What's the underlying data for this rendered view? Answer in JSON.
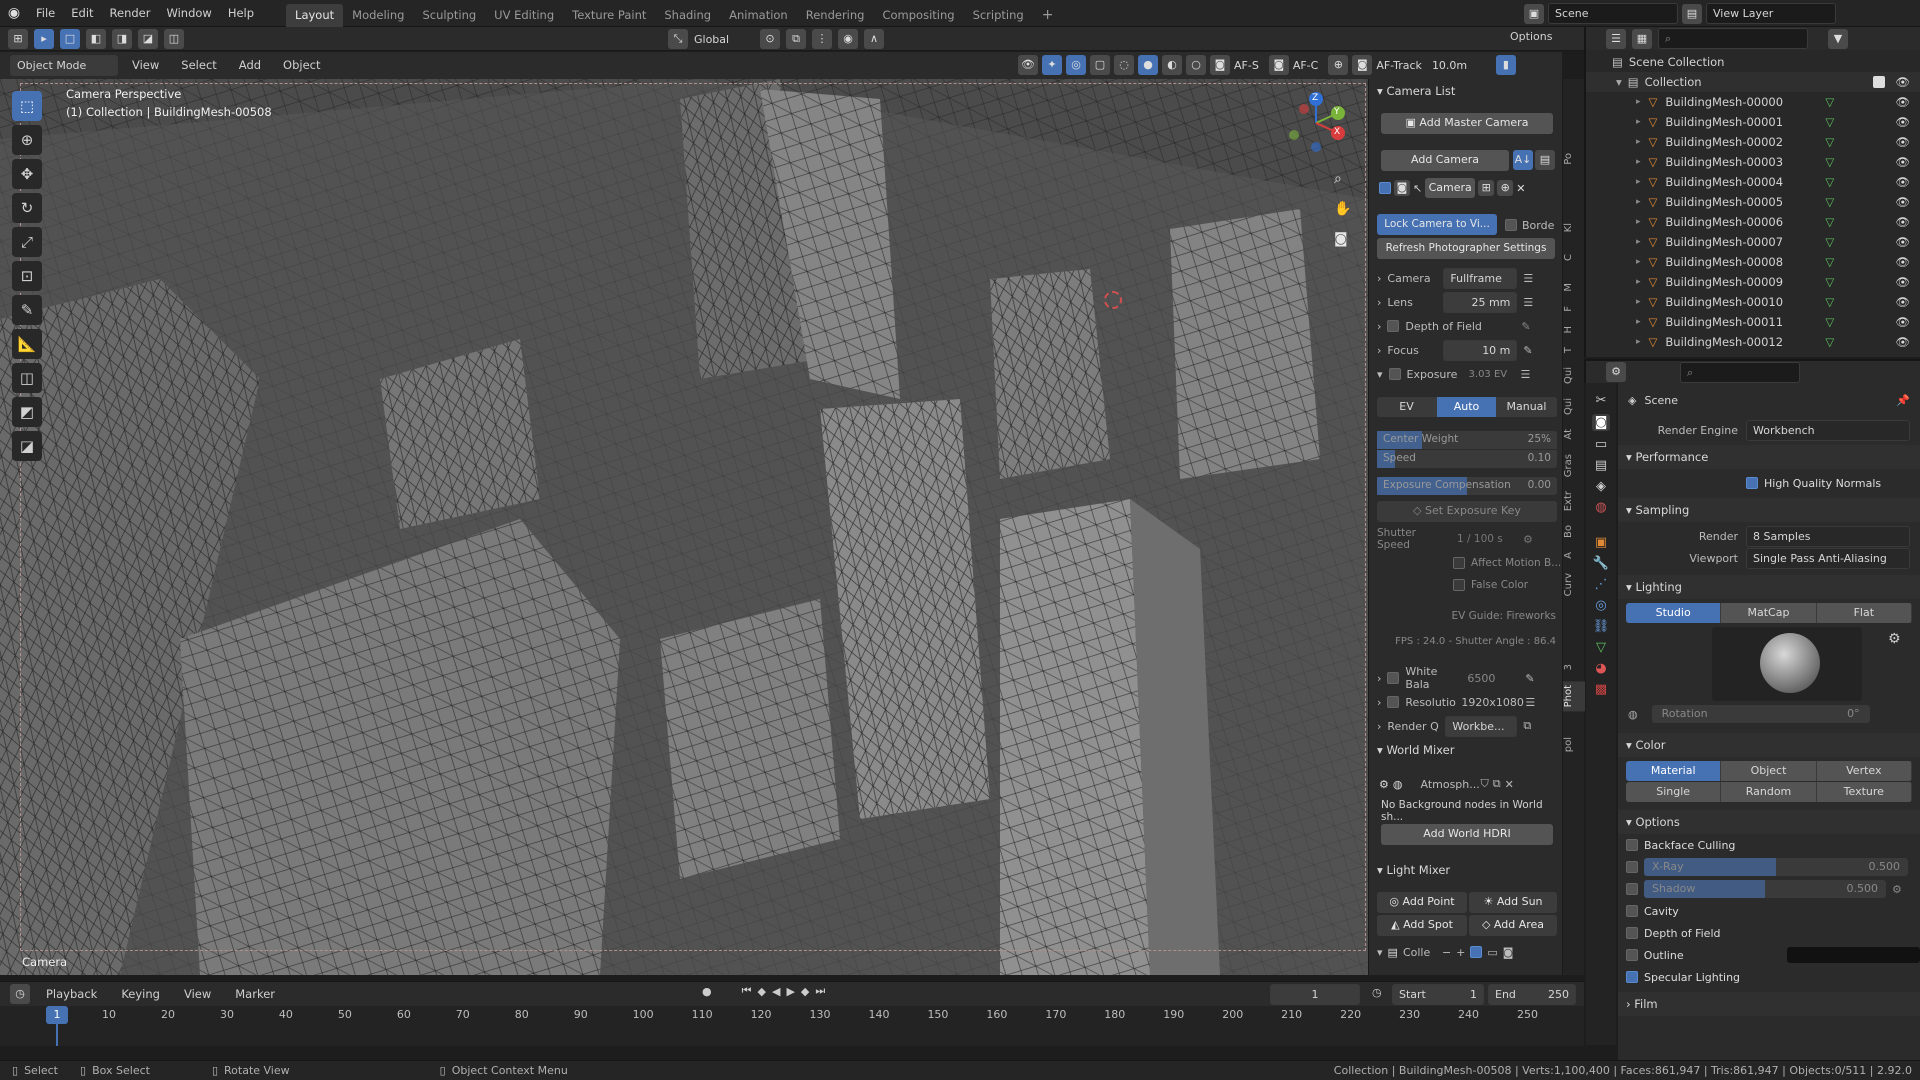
{
  "topbar": {
    "menus": [
      "File",
      "Edit",
      "Render",
      "Window",
      "Help"
    ],
    "workspaces": [
      "Layout",
      "Modeling",
      "Sculpting",
      "UV Editing",
      "Texture Paint",
      "Shading",
      "Animation",
      "Rendering",
      "Compositing",
      "Scripting"
    ],
    "active_workspace": "Layout",
    "scene_field": "Scene",
    "view_layer_field": "View Layer"
  },
  "toolbar2": {
    "transform_orientation": "Global",
    "options_label": "Options"
  },
  "viewport_header": {
    "mode": "Object Mode",
    "menus": [
      "View",
      "Select",
      "Add",
      "Object"
    ],
    "af_s": "AF-S",
    "af_c": "AF-C",
    "af_track": "AF-Track",
    "distance": "10.0m"
  },
  "viewport": {
    "line1": "Camera Perspective",
    "line2": "(1) Collection | BuildingMesh-00508",
    "bottom_label": "Camera",
    "bg_color": "#4d4d4d",
    "gizmo_x": "X",
    "gizmo_y": "Y",
    "gizmo_z": "Z"
  },
  "npanel": {
    "camera_list_title": "Camera List",
    "add_master_camera": "Add Master Camera",
    "add_camera": "Add Camera",
    "camera_name": "Camera",
    "lock_camera": "Lock Camera to Vi...",
    "border": "Borde",
    "refresh": "Refresh Photographer Settings",
    "camera_label": "Camera",
    "camera_value": "Fullframe",
    "lens_label": "Lens",
    "lens_value": "25 mm",
    "dof_label": "Depth of Field",
    "focus_label": "Focus",
    "focus_value": "10 m",
    "exposure_label": "Exposure",
    "exposure_value": "3.03 EV",
    "exp_modes": [
      "EV",
      "Auto",
      "Manual"
    ],
    "exp_mode_active": "Auto",
    "center_weight_label": "Center Weight",
    "center_weight_value": "25%",
    "speed_label": "Speed",
    "speed_value": "0.10",
    "exp_comp_label": "Exposure Compensation",
    "exp_comp_value": "0.00",
    "set_exposure_key": "Set Exposure Key",
    "shutter_label": "Shutter Speed",
    "shutter_value": "1 / 100 s",
    "affect_motion": "Affect Motion B...",
    "false_color": "False Color",
    "ev_guide": "EV Guide: Fireworks",
    "fps_line": "FPS : 24.0 - Shutter Angle : 86.4",
    "white_balance_label": "White Bala",
    "white_balance_value": "6500",
    "resolution_label": "Resolutio",
    "resolution_value": "1920x1080",
    "render_q_label": "Render Q",
    "render_q_value": "Workbe...",
    "world_mixer_title": "World Mixer",
    "world_name": "Atmosph...",
    "no_bg_nodes": "No Background nodes in World sh...",
    "add_world_hdri": "Add World HDRI",
    "light_mixer_title": "Light Mixer",
    "add_point": "Add Point",
    "add_sun": "Add Sun",
    "add_spot": "Add Spot",
    "add_area": "Add Area",
    "collection_short": "Colle"
  },
  "vtabs": [
    "Po",
    "Kl",
    "C",
    "M",
    "F",
    "H",
    "T",
    "Qui",
    "Qui",
    "At",
    "Gras",
    "Extr",
    "Bo",
    "A",
    "Curv",
    "3",
    "Phot",
    "pol"
  ],
  "outliner": {
    "root": "Scene Collection",
    "collection": "Collection",
    "items": [
      "BuildingMesh-00000",
      "BuildingMesh-00001",
      "BuildingMesh-00002",
      "BuildingMesh-00003",
      "BuildingMesh-00004",
      "BuildingMesh-00005",
      "BuildingMesh-00006",
      "BuildingMesh-00007",
      "BuildingMesh-00008",
      "BuildingMesh-00009",
      "BuildingMesh-00010",
      "BuildingMesh-00011",
      "BuildingMesh-00012"
    ]
  },
  "props": {
    "scene_label": "Scene",
    "render_engine_label": "Render Engine",
    "render_engine_value": "Workbench",
    "performance_title": "Performance",
    "high_quality_normals": "High Quality Normals",
    "sampling_title": "Sampling",
    "render_label": "Render",
    "render_value": "8 Samples",
    "viewport_label": "Viewport",
    "viewport_value": "Single Pass Anti-Aliasing",
    "lighting_title": "Lighting",
    "lighting_modes": [
      "Studio",
      "MatCap",
      "Flat"
    ],
    "lighting_active": "Studio",
    "rotation_label": "Rotation",
    "rotation_value": "0°",
    "color_title": "Color",
    "color_modes": [
      "Material",
      "Object",
      "Vertex",
      "Single",
      "Random",
      "Texture"
    ],
    "color_active": "Material",
    "options_title": "Options",
    "backface_culling": "Backface Culling",
    "xray_label": "X-Ray",
    "xray_value": "0.500",
    "xray_fraction": 0.5,
    "shadow_label": "Shadow",
    "shadow_value": "0.500",
    "shadow_fraction": 0.5,
    "cavity": "Cavity",
    "depth_of_field": "Depth of Field",
    "outline": "Outline",
    "specular_lighting": "Specular Lighting",
    "film_title": "Film"
  },
  "timeline": {
    "menus": [
      "Playback",
      "Keying",
      "View",
      "Marker"
    ],
    "current_frame": "1",
    "start_label": "Start",
    "start_value": "1",
    "end_label": "End",
    "end_value": "250",
    "ticks": [
      "10",
      "20",
      "30",
      "40",
      "50",
      "60",
      "70",
      "80",
      "90",
      "100",
      "110",
      "120",
      "130",
      "140",
      "150",
      "160",
      "170",
      "180",
      "190",
      "200",
      "210",
      "220",
      "230",
      "240",
      "250"
    ],
    "cursor_frame": "1"
  },
  "statusbar": {
    "select": "Select",
    "box_select": "Box Select",
    "rotate_view": "Rotate View",
    "context_menu": "Object Context Menu",
    "stats": "Collection | BuildingMesh-00508 | Verts:1,100,400 | Faces:861,947 | Tris:861,947 | Objects:0/511 | 2.92.0"
  }
}
